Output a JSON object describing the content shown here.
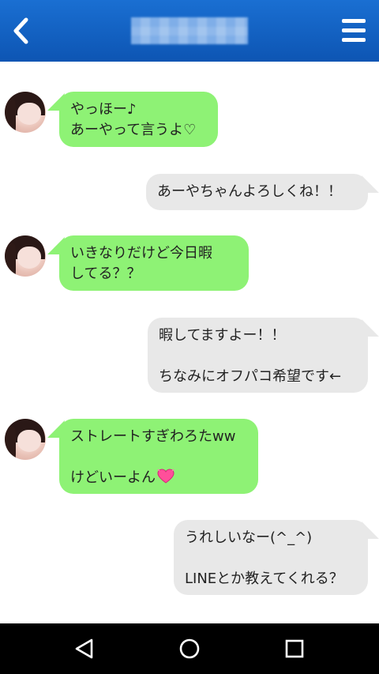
{
  "header": {
    "title": "■■■■■■",
    "back_icon": "chevron-left-icon",
    "menu_icon": "hamburger-menu-icon",
    "background_color": "#1565c0"
  },
  "messages": [
    {
      "side": "in",
      "text": "やっほー♪\nあーやって言うよ♡"
    },
    {
      "side": "out",
      "text": "あーやちゃんよろしくね！！"
    },
    {
      "side": "in",
      "text": "いきなりだけど今日暇\nしてる？？"
    },
    {
      "side": "out",
      "text": "暇してますよー！！\n\nちなみにオフパコ希望です←"
    },
    {
      "side": "in",
      "text": "ストレートすぎわろたww\n\nけどいーよん",
      "emoji": "heart-emoji"
    },
    {
      "side": "out",
      "text": "うれしいなー(^_^)\n\nLINEとか教えてくれる？"
    }
  ],
  "colors": {
    "incoming_bubble": "#8ef275",
    "outgoing_bubble": "#e8e8e8",
    "navbar": "#000000"
  },
  "navbar": {
    "back_icon": "triangle-back-icon",
    "home_icon": "circle-home-icon",
    "recents_icon": "square-recents-icon"
  }
}
